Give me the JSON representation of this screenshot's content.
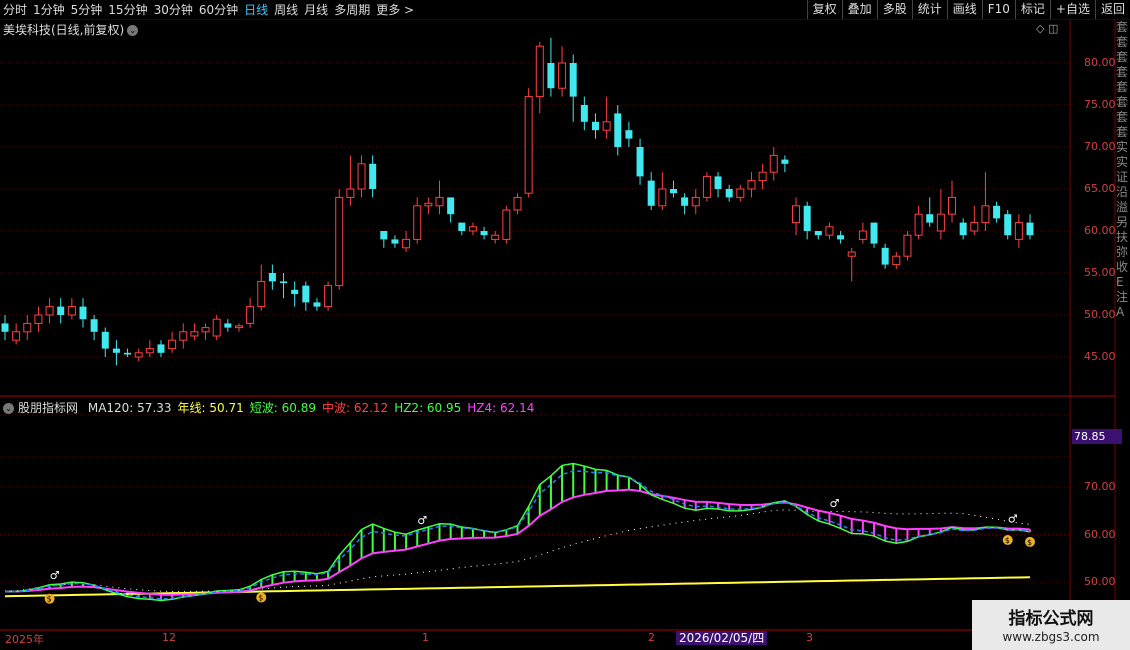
{
  "toolbar": {
    "periods": [
      "分时",
      "1分钟",
      "5分钟",
      "15分钟",
      "30分钟",
      "60分钟",
      "日线",
      "周线",
      "月线",
      "多周期",
      "更多 >"
    ],
    "active_period": "日线",
    "actions": [
      "复权",
      "叠加",
      "多股",
      "统计",
      "画线",
      "F10",
      "标记",
      "+自选",
      "返回"
    ]
  },
  "stock": {
    "title": "美埃科技(日线,前复权)"
  },
  "price_axis": {
    "ticks": [
      "80.00",
      "75.00",
      "70.00",
      "65.00",
      "60.00",
      "55.00",
      "50.00",
      "45.00"
    ]
  },
  "indicator": {
    "name": "股朋指标网",
    "legend": [
      {
        "label": "MA120: 57.33",
        "color": "#dddddd"
      },
      {
        "label": "年线: 50.71",
        "color": "#ffff40"
      },
      {
        "label": "短波: 60.89",
        "color": "#40ff40"
      },
      {
        "label": "中波: 62.12",
        "color": "#ff4040"
      },
      {
        "label": "HZ2: 60.95",
        "color": "#40ff40"
      },
      {
        "label": "HZ4: 62.14",
        "color": "#ff40ff"
      }
    ],
    "axis_ticks": [
      "70.00",
      "60.00",
      "50.00"
    ],
    "highlight_value": "78.85"
  },
  "x_axis": {
    "labels": [
      "2025年",
      "12",
      "1",
      "2",
      "3"
    ],
    "cursor_date": "2026/02/05/四"
  },
  "right_column": [
    "套",
    "套",
    "套",
    "套",
    "套",
    "套",
    "套",
    "套",
    "实",
    "实",
    "证",
    "沿",
    "溢",
    "另",
    "扶",
    "弥",
    "收",
    "E",
    "注",
    "A"
  ],
  "watermark": {
    "line1": "指标公式网",
    "line2": "www.zbgs3.com"
  },
  "colors": {
    "up": "#ff4040",
    "down": "#40e8f0",
    "grid": "#5a0000",
    "green": "#40ff40",
    "magenta": "#ff40ff",
    "yellow": "#ffff40"
  },
  "chart_data": {
    "type": "candlestick",
    "ylim": [
      42,
      85
    ],
    "candles": [
      [
        49,
        48,
        50,
        47
      ],
      [
        47,
        48,
        49,
        46.5
      ],
      [
        48,
        49,
        50,
        47
      ],
      [
        49,
        50,
        51,
        48
      ],
      [
        50,
        51,
        52,
        49
      ],
      [
        51,
        50,
        52,
        49
      ],
      [
        50,
        51,
        52,
        49.5
      ],
      [
        51,
        49.5,
        52,
        48.5
      ],
      [
        49.5,
        48,
        50,
        47
      ],
      [
        48,
        46,
        48.5,
        45
      ],
      [
        46,
        45.5,
        47,
        44
      ],
      [
        45.5,
        45.3,
        46,
        45
      ],
      [
        45,
        45.5,
        46,
        44.5
      ],
      [
        45.5,
        46,
        47,
        45
      ],
      [
        46.5,
        45.5,
        47,
        45
      ],
      [
        46,
        47,
        48,
        45.5
      ],
      [
        47,
        48,
        49,
        46
      ],
      [
        47.5,
        48,
        49,
        47
      ],
      [
        48,
        48.5,
        49,
        47
      ],
      [
        47.5,
        49.5,
        50,
        47
      ],
      [
        49,
        48.5,
        49.5,
        48
      ],
      [
        48.5,
        48.7,
        49,
        48
      ],
      [
        49,
        51,
        52,
        48.5
      ],
      [
        51,
        54,
        56,
        50.5
      ],
      [
        55,
        54,
        56,
        53
      ],
      [
        54,
        53.8,
        55,
        52
      ],
      [
        53,
        52.5,
        54,
        51
      ],
      [
        53.5,
        51.5,
        54,
        50.5
      ],
      [
        51.5,
        51,
        52,
        50.5
      ],
      [
        51,
        53.5,
        54,
        50.5
      ],
      [
        53.5,
        64,
        65,
        53
      ],
      [
        64,
        65,
        69,
        63
      ],
      [
        65,
        68,
        69,
        64
      ],
      [
        68,
        65,
        69,
        64
      ],
      [
        60,
        59,
        60,
        58
      ],
      [
        59,
        58.5,
        59.5,
        58
      ],
      [
        58,
        59,
        60,
        57.5
      ],
      [
        59,
        63,
        64,
        58.5
      ],
      [
        63,
        63.3,
        64,
        62
      ],
      [
        63,
        64,
        66,
        62
      ],
      [
        64,
        62,
        64,
        61
      ],
      [
        61,
        60,
        61,
        59.5
      ],
      [
        60,
        60.5,
        61,
        59.5
      ],
      [
        60,
        59.5,
        60.5,
        59
      ],
      [
        59,
        59.5,
        60,
        58.5
      ],
      [
        59,
        62.5,
        63,
        58.5
      ],
      [
        62.5,
        64,
        64.5,
        62
      ],
      [
        64.5,
        76,
        77,
        64
      ],
      [
        76,
        82,
        82.5,
        74
      ],
      [
        80,
        77,
        83,
        76
      ],
      [
        77,
        80,
        82,
        76
      ],
      [
        80,
        76,
        81,
        73
      ],
      [
        75,
        73,
        76,
        72
      ],
      [
        73,
        72,
        74,
        71
      ],
      [
        72,
        73,
        76,
        71
      ],
      [
        74,
        70,
        75,
        69
      ],
      [
        72,
        71,
        73,
        70
      ],
      [
        70,
        66.5,
        71,
        65.5
      ],
      [
        66,
        63,
        67,
        62.5
      ],
      [
        63,
        65,
        67,
        62.5
      ],
      [
        65,
        64.5,
        66,
        64
      ],
      [
        64,
        63,
        64.5,
        62
      ],
      [
        63,
        64,
        65,
        62
      ],
      [
        64,
        66.5,
        67,
        63.5
      ],
      [
        66.5,
        65,
        67,
        64
      ],
      [
        65,
        64,
        65.5,
        63.5
      ],
      [
        64,
        65,
        65.5,
        63.5
      ],
      [
        65,
        66,
        67,
        64
      ],
      [
        66,
        67,
        68,
        65
      ],
      [
        67,
        69,
        70,
        66
      ],
      [
        68.5,
        68,
        69,
        67
      ],
      [
        61,
        63,
        64,
        59.5
      ],
      [
        63,
        60,
        63.5,
        59
      ],
      [
        60,
        59.5,
        60,
        59
      ],
      [
        59.5,
        60.5,
        61,
        59
      ],
      [
        59.5,
        59,
        60,
        58.5
      ],
      [
        57,
        57.5,
        58,
        54
      ],
      [
        59,
        60,
        61,
        58.5
      ],
      [
        61,
        58.5,
        61,
        58
      ],
      [
        58,
        56,
        58.5,
        55.5
      ],
      [
        56,
        57,
        57.5,
        55.5
      ],
      [
        57,
        59.5,
        60,
        56.5
      ],
      [
        59.5,
        62,
        63,
        59
      ],
      [
        62,
        61,
        64,
        60.5
      ],
      [
        60,
        62,
        65,
        59
      ],
      [
        62,
        64,
        66,
        61
      ],
      [
        61,
        59.5,
        61.5,
        59
      ],
      [
        60,
        61,
        63,
        59.5
      ],
      [
        61,
        63,
        67,
        60
      ],
      [
        63,
        61.5,
        63.5,
        61
      ],
      [
        62,
        59.5,
        62.5,
        59
      ],
      [
        59,
        61,
        62,
        58
      ],
      [
        61,
        59.5,
        62,
        59
      ]
    ]
  }
}
